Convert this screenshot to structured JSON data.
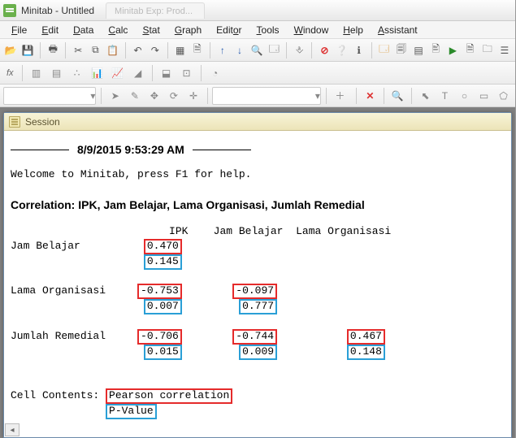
{
  "window": {
    "title": "Minitab - Untitled",
    "ghost_tab": "Minitab Exp: Prod..."
  },
  "menu": {
    "items": [
      {
        "label": "File",
        "ul": "F"
      },
      {
        "label": "Edit",
        "ul": "E"
      },
      {
        "label": "Data",
        "ul": "D"
      },
      {
        "label": "Calc",
        "ul": "C"
      },
      {
        "label": "Stat",
        "ul": "S"
      },
      {
        "label": "Graph",
        "ul": "G"
      },
      {
        "label": "Editor",
        "ul": "E"
      },
      {
        "label": "Tools",
        "ul": "T"
      },
      {
        "label": "Window",
        "ul": "W"
      },
      {
        "label": "Help",
        "ul": "H"
      },
      {
        "label": "Assistant",
        "ul": "A"
      }
    ]
  },
  "toolbar2": {
    "fx": "fx"
  },
  "session": {
    "title": "Session",
    "timestamp": "8/9/2015 9:53:29 AM",
    "welcome": "Welcome to Minitab, press F1 for help.",
    "section": "Correlation: IPK, Jam Belajar, Lama Organisasi, Jumlah Remedial",
    "headers": {
      "c1": "IPK",
      "c2": "Jam Belajar",
      "c3": "Lama Organisasi"
    },
    "rows": {
      "r1": {
        "label": "Jam Belajar",
        "v1": "0.470",
        "p1": "0.145"
      },
      "r2": {
        "label": "Lama Organisasi",
        "v1": "-0.753",
        "p1": "0.007",
        "v2": "-0.097",
        "p2": "0.777"
      },
      "r3": {
        "label": "Jumlah Remedial",
        "v1": "-0.706",
        "p1": "0.015",
        "v2": "-0.744",
        "p2": "0.009",
        "v3": "0.467",
        "p3": "0.148"
      }
    },
    "cell_contents_label": "Cell Contents:",
    "cell_contents_1": "Pearson correlation",
    "cell_contents_2": "P-Value"
  },
  "chart_data": {
    "type": "table",
    "title": "Correlation: IPK, Jam Belajar, Lama Organisasi, Jumlah Remedial",
    "columns": [
      "IPK",
      "Jam Belajar",
      "Lama Organisasi"
    ],
    "rows": [
      "Jam Belajar",
      "Lama Organisasi",
      "Jumlah Remedial"
    ],
    "pearson": [
      [
        0.47,
        null,
        null
      ],
      [
        -0.753,
        -0.097,
        null
      ],
      [
        -0.706,
        -0.744,
        0.467
      ]
    ],
    "p_value": [
      [
        0.145,
        null,
        null
      ],
      [
        0.007,
        0.777,
        null
      ],
      [
        0.015,
        0.009,
        0.148
      ]
    ],
    "cell_contents": [
      "Pearson correlation",
      "P-Value"
    ]
  }
}
